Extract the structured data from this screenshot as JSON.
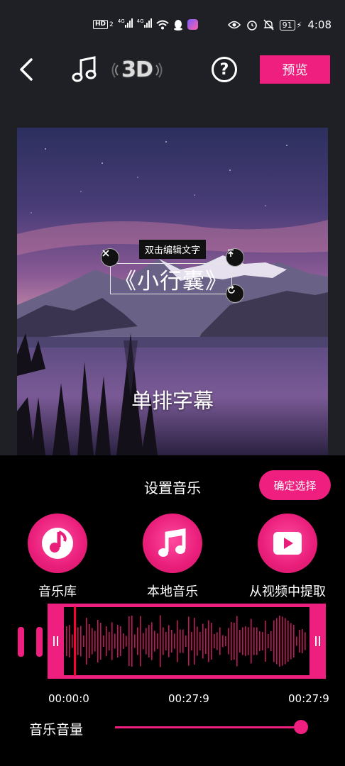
{
  "status_bar": {
    "hd_label": "HD",
    "sim_slot": "2",
    "network_1": "4G",
    "network_2": "4G",
    "battery": "91",
    "time": "4:08"
  },
  "toolbar": {
    "threed_label": "3D",
    "help_label": "?",
    "preview_label": "预览"
  },
  "editor": {
    "tooltip": "双击编辑文字",
    "title_text": "《小行囊》",
    "subtitle_text": "单排字幕"
  },
  "music_panel": {
    "title": "设置音乐",
    "confirm_label": "确定选择",
    "sources": [
      {
        "label": "音乐库",
        "icon": "music-library-icon"
      },
      {
        "label": "本地音乐",
        "icon": "music-note-icon"
      },
      {
        "label": "从视频中提取",
        "icon": "play-video-icon"
      }
    ],
    "start_time": "00:00:0",
    "selected_end_time": "00:27:9",
    "total_time": "00:27:9",
    "volume_label": "音乐音量",
    "volume_level": 1.0
  },
  "colors": {
    "accent": "#ee1f7e",
    "background": "#1f2025",
    "panel": "#000000"
  }
}
